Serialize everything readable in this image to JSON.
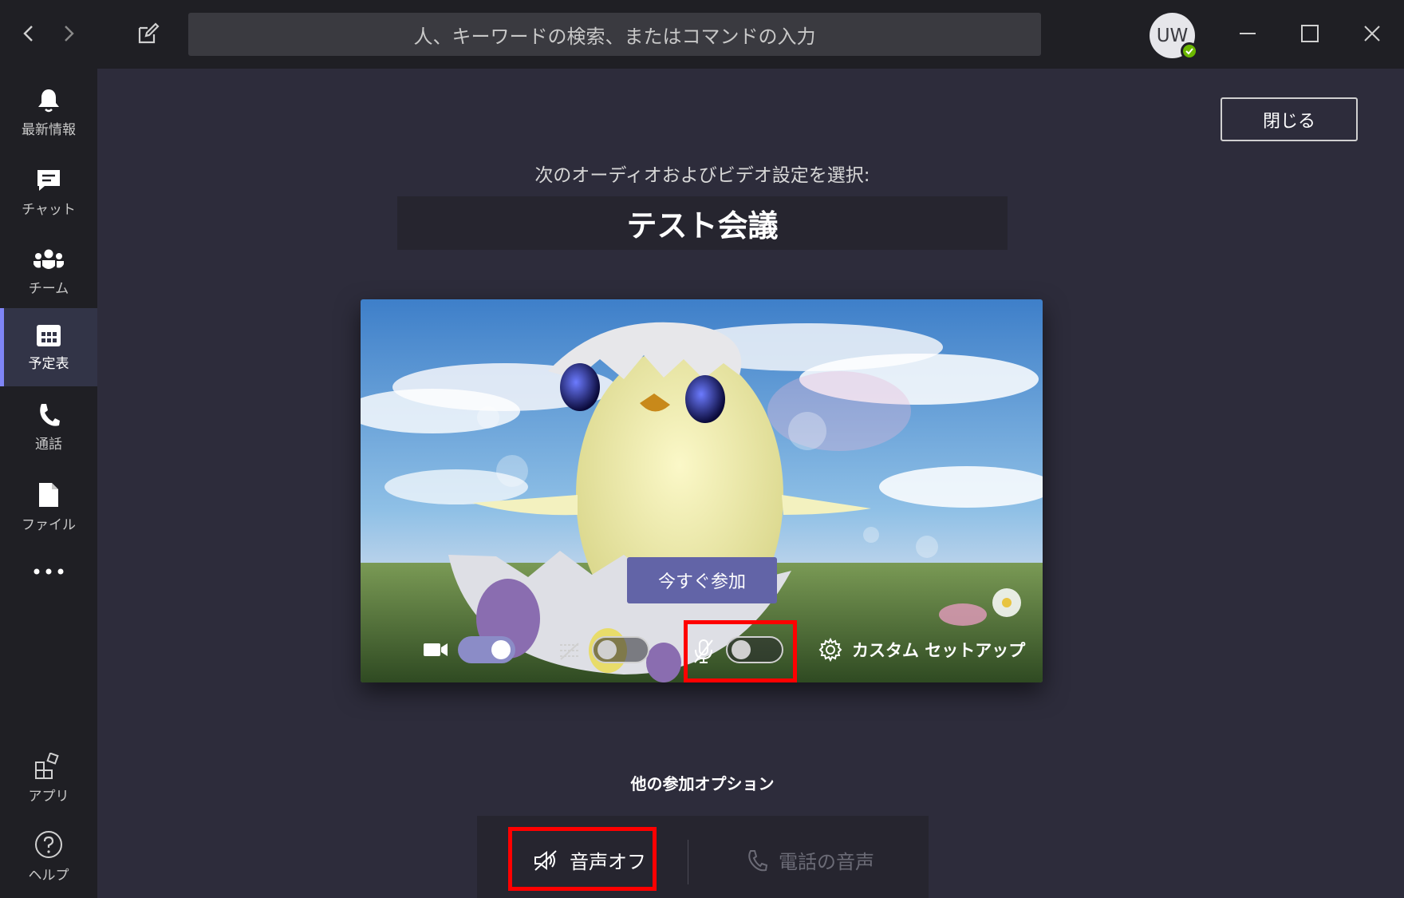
{
  "titlebar": {
    "search_placeholder": "人、キーワードの検索、またはコマンドの入力",
    "avatar_initials": "UW"
  },
  "rail": {
    "items": [
      {
        "label": "最新情報",
        "icon": "bell-icon"
      },
      {
        "label": "チャット",
        "icon": "chat-icon"
      },
      {
        "label": "チーム",
        "icon": "teams-icon"
      },
      {
        "label": "予定表",
        "icon": "calendar-icon"
      },
      {
        "label": "通話",
        "icon": "phone-icon"
      },
      {
        "label": "ファイル",
        "icon": "file-icon"
      },
      {
        "label": "",
        "icon": "more-icon"
      },
      {
        "label": "アプリ",
        "icon": "apps-icon"
      },
      {
        "label": "ヘルプ",
        "icon": "help-icon"
      }
    ],
    "active_item": "予定表"
  },
  "main": {
    "close_label": "閉じる",
    "subtitle": "次のオーディオおよびビデオ設定を選択:",
    "meeting_title": "テスト会議",
    "join_label": "今すぐ参加",
    "camera_on": true,
    "background_blur_on": false,
    "mic_on": false,
    "custom_setup_label": "カスタム セットアップ",
    "other_options_label": "他の参加オプション",
    "audio_off_label": "音声オフ",
    "phone_audio_label": "電話の音声"
  },
  "colors": {
    "accent": "#6264a7",
    "highlight": "#ff0000"
  }
}
